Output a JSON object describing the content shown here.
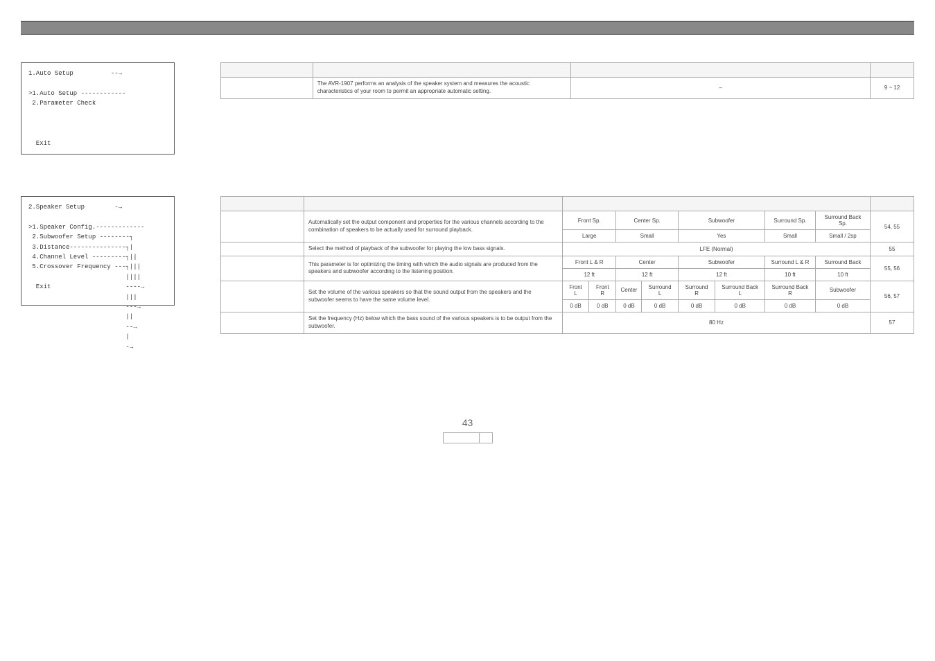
{
  "page_number": "43",
  "section1": {
    "menu": "1.Auto Setup          --→\n\n>1.Auto Setup ------------\n 2.Parameter Check\n\n\n\n  Exit",
    "header_cells": [
      "",
      "",
      "",
      ""
    ],
    "row": {
      "item": "",
      "desc": "The AVR-1907 performs an analysis of the speaker system and measures the acoustic characteristics of your room to permit an appropriate automatic setting.",
      "default": "–",
      "page": "9 ~ 12"
    }
  },
  "section2": {
    "menu": "2.Speaker Setup        -→\n\n>1.Speaker Config.-------------\n 2.Subwoofer Setup --------┐\n 3.Distance---------------┐|\n 4.Channel Level ---------┐||\n 5.Crossover Frequency ---┐|||\n                          ||||\n  Exit                    ----→\n                          |||\n                          ---→\n                          ||\n                          --→\n                          |\n                          -→",
    "header_cells": [
      "",
      "",
      "",
      ""
    ],
    "rows": [
      {
        "item": "",
        "desc": "Automatically set the output component and properties for the various channels according to the combination of speakers to be actually used for surround playback.",
        "defaults_row1": [
          "Front Sp.",
          "Center Sp.",
          "Subwoofer",
          "Surround Sp.",
          "Surround Back Sp."
        ],
        "defaults_row2": [
          "Large",
          "Small",
          "Yes",
          "Small",
          "Small / 2sp"
        ],
        "page": "54, 55"
      },
      {
        "item": "",
        "desc": "Select the method of playback of the subwoofer for playing the low bass signals.",
        "default_single": "LFE (Normal)",
        "page": "55"
      },
      {
        "item": "",
        "desc": "This parameter is for optimizing the timing with which the audio signals are produced from the speakers and subwoofer according to the listening position.",
        "defaults_row1": [
          "Front L & R",
          "Center",
          "Subwoofer",
          "Surround L & R",
          "Surround Back"
        ],
        "defaults_row2": [
          "12 ft",
          "12 ft",
          "12 ft",
          "10 ft",
          "10 ft"
        ],
        "page": "55, 56"
      },
      {
        "item": "",
        "desc": "Set the volume of the various speakers so that the sound output from the speakers and the subwoofer seems to have the same volume level.",
        "defaults_row1": [
          "Front L",
          "Front R",
          "Center",
          "Surround L",
          "Surround R",
          "Surround Back L",
          "Surround Back R",
          "Subwoofer"
        ],
        "defaults_row2": [
          "0 dB",
          "0 dB",
          "0 dB",
          "0 dB",
          "0 dB",
          "0 dB",
          "0 dB",
          "0 dB"
        ],
        "page": "56, 57"
      },
      {
        "item": "",
        "desc": "Set the frequency (Hz) below which the bass sound of the various speakers is to be output from the subwoofer.",
        "default_single": "80 Hz",
        "page": "57"
      }
    ]
  }
}
